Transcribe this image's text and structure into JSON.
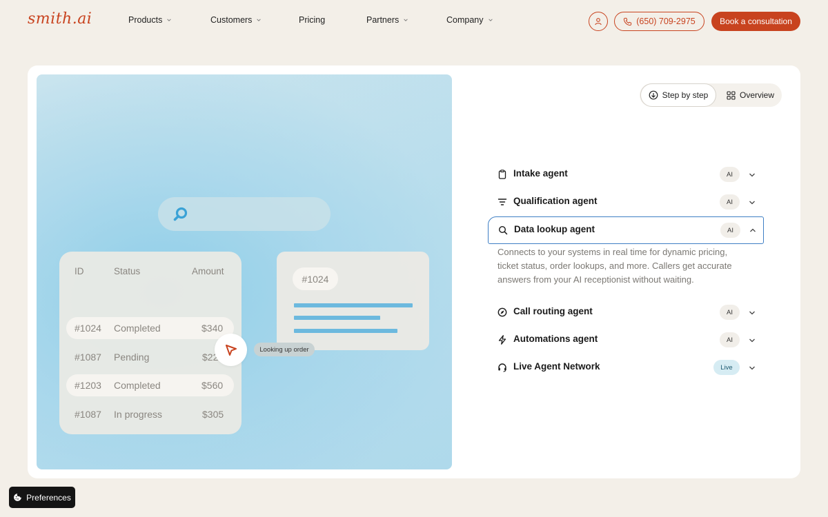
{
  "brand": {
    "logo_text": "smith.ai",
    "accent": "#c8431f"
  },
  "nav": {
    "items": [
      {
        "label": "Products",
        "dropdown": true
      },
      {
        "label": "Customers",
        "dropdown": true
      },
      {
        "label": "Pricing",
        "dropdown": false
      },
      {
        "label": "Partners",
        "dropdown": true
      },
      {
        "label": "Company",
        "dropdown": true
      }
    ],
    "phone": "(650) 709-2975",
    "cta": "Book a consultation"
  },
  "illustration": {
    "table": {
      "headers": [
        "ID",
        "Status",
        "Amount"
      ],
      "rows": [
        {
          "id": "#1024",
          "status": "Completed",
          "amount": "$340",
          "highlighted": true
        },
        {
          "id": "#1087",
          "status": "Pending",
          "amount": "$22",
          "highlighted": false
        },
        {
          "id": "#1203",
          "status": "Completed",
          "amount": "$560",
          "highlighted": true
        },
        {
          "id": "#1087",
          "status": "In progress",
          "amount": "$305",
          "highlighted": false
        }
      ]
    },
    "detail_order": "#1024",
    "status_pill": "Looking up order"
  },
  "view_toggle": {
    "step_by_step": "Step by step",
    "overview": "Overview",
    "active": "step_by_step"
  },
  "agents": [
    {
      "name": "Intake agent",
      "badge": "AI",
      "icon": "clipboard-icon",
      "open": false
    },
    {
      "name": "Qualification agent",
      "badge": "AI",
      "icon": "filter-icon",
      "open": false
    },
    {
      "name": "Data lookup agent",
      "badge": "AI",
      "icon": "search-icon",
      "open": true,
      "description": "Connects to your systems in real time for dynamic pricing, ticket status, order lookups, and more. Callers get accurate answers from your AI receptionist without waiting."
    },
    {
      "name": "Call routing agent",
      "badge": "AI",
      "icon": "compass-icon",
      "open": false
    },
    {
      "name": "Automations agent",
      "badge": "AI",
      "icon": "lightning-icon",
      "open": false
    },
    {
      "name": "Live Agent Network",
      "badge": "Live",
      "icon": "headset-icon",
      "open": false
    }
  ],
  "preferences": {
    "label": "Preferences"
  }
}
